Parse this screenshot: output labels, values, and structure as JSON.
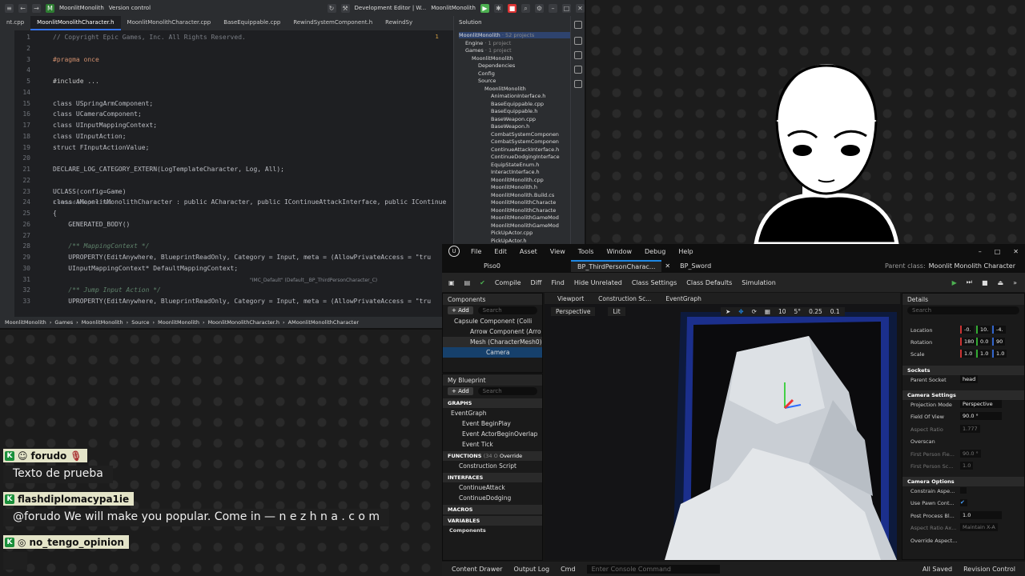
{
  "ide": {
    "title_items": [
      "MoonlitMonolith",
      "Version control",
      "Development Editor | W...",
      "MoonlitMonolith"
    ],
    "tabs": [
      "nt.cpp",
      "MoonlitMonolithCharacter.h",
      "MoonlitMonolithCharacter.cpp",
      "BaseEquippable.cpp",
      "RewindSystemComponent.h",
      "RewindSy"
    ],
    "inspection": "1",
    "lines": [
      {
        "n": "1",
        "t": "// Copyright Epic Games, Inc. All Rights Reserved.",
        "c": "cm"
      },
      {
        "n": "2",
        "t": ""
      },
      {
        "n": "3",
        "t": "#pragma once",
        "c": "kw"
      },
      {
        "n": "4",
        "t": ""
      },
      {
        "n": "5",
        "t": "#include ...",
        "c": "cls"
      },
      {
        "n": "14",
        "t": ""
      },
      {
        "n": "15",
        "t": "class USpringArmComponent;"
      },
      {
        "n": "16",
        "t": "class UCameraComponent;"
      },
      {
        "n": "17",
        "t": "class UInputMappingContext;"
      },
      {
        "n": "18",
        "t": "class UInputAction;"
      },
      {
        "n": "19",
        "t": "struct FInputActionValue;"
      },
      {
        "n": "20",
        "t": ""
      },
      {
        "n": "21",
        "t": "DECLARE_LOG_CATEGORY_EXTERN(LogTemplateCharacter, Log, All);"
      },
      {
        "n": "22",
        "t": ""
      },
      {
        "n": "23",
        "t": "UCLASS(config=Game)"
      },
      {
        "n": "24",
        "t": "class AMoonlitMonolithCharacter : public ACharacter, public IContinueAttackInterface, public IContinue"
      },
      {
        "n": "25",
        "t": "{"
      },
      {
        "n": "26",
        "t": "    GENERATED_BODY()"
      },
      {
        "n": "27",
        "t": ""
      },
      {
        "n": "28",
        "t": "    /** MappingContext */",
        "c": "cmg"
      },
      {
        "n": "29",
        "t": "    UPROPERTY(EditAnywhere, BlueprintReadOnly, Category = Input, meta = (AllowPrivateAccess = \"tru"
      },
      {
        "n": "30",
        "t": "    UInputMappingContext* DefaultMappingContext;"
      },
      {
        "n": "31",
        "t": ""
      },
      {
        "n": "32",
        "t": "    /** Jump Input Action */",
        "c": "cmg"
      },
      {
        "n": "33",
        "t": "    UPROPERTY(EditAnywhere, BlueprintReadOnly, Category = Input, meta = (AllowPrivateAccess = \"tru"
      }
    ],
    "hint_derived": "1 derived blueprint class",
    "hint_imc": "\"IMC_Default\" (Default__BP_ThirdPersonCharacter_C)",
    "breadcrumb": [
      "MoonlitMonolith",
      "Games",
      "MoonlitMonolith",
      "Source",
      "MoonlitMonolith",
      "MoonlitMonolithCharacter.h",
      "AMoonlitMonolithCharacter"
    ],
    "solution": {
      "header": "Solution",
      "nodes": [
        {
          "label": "MoonlitMonolith",
          "dim": " · 52 projects",
          "lvl": 0
        },
        {
          "label": "Engine",
          "dim": " · 1 project",
          "lvl": 1
        },
        {
          "label": "Games",
          "dim": " · 1 project",
          "lvl": 1
        },
        {
          "label": "MoonlitMonolith",
          "dim": "",
          "lvl": 2
        },
        {
          "label": "Dependencies",
          "dim": "",
          "lvl": 3
        },
        {
          "label": "Config",
          "dim": "",
          "lvl": 3
        },
        {
          "label": "Source",
          "dim": "",
          "lvl": 3
        },
        {
          "label": "MoonlitMonolith",
          "dim": "",
          "lvl": 4
        },
        {
          "label": "AnimationInterface.h",
          "dim": "",
          "lvl": 5
        },
        {
          "label": "BaseEquippable.cpp",
          "dim": "",
          "lvl": 5
        },
        {
          "label": "BaseEquippable.h",
          "dim": "",
          "lvl": 5
        },
        {
          "label": "BaseWeapon.cpp",
          "dim": "",
          "lvl": 5
        },
        {
          "label": "BaseWeapon.h",
          "dim": "",
          "lvl": 5
        },
        {
          "label": "CombatSystemComponen",
          "dim": "",
          "lvl": 5
        },
        {
          "label": "CombatSystemComponen",
          "dim": "",
          "lvl": 5
        },
        {
          "label": "ContinueAttackInterface.h",
          "dim": "",
          "lvl": 5
        },
        {
          "label": "ContinueDodgingInterface",
          "dim": "",
          "lvl": 5
        },
        {
          "label": "EquipStateEnum.h",
          "dim": "",
          "lvl": 5
        },
        {
          "label": "InteractInterface.h",
          "dim": "",
          "lvl": 5
        },
        {
          "label": "MoonlitMonolith.cpp",
          "dim": "",
          "lvl": 5
        },
        {
          "label": "MoonlitMonolith.h",
          "dim": "",
          "lvl": 5
        },
        {
          "label": "MoonlitMonolith.Build.cs",
          "dim": "",
          "lvl": 5
        },
        {
          "label": "MoonlitMonolithCharacte",
          "dim": "",
          "lvl": 5
        },
        {
          "label": "MoonlitMonolithCharacte",
          "dim": "",
          "lvl": 5
        },
        {
          "label": "MoonlitMonolithGameMod",
          "dim": "",
          "lvl": 5
        },
        {
          "label": "MoonlitMonolithGameMod",
          "dim": "",
          "lvl": 5
        },
        {
          "label": "PickUpActor.cpp",
          "dim": "",
          "lvl": 5
        },
        {
          "label": "PickUpActor.h",
          "dim": "",
          "lvl": 5
        }
      ]
    }
  },
  "chat": [
    {
      "user": "forudo",
      "msg": "Texto de prueba"
    },
    {
      "user": "flashdiplomacypa1ie",
      "msg": "@forudo We will make you popular. Come in — n e z h n a . c o m"
    },
    {
      "user": "no_tengo_opinion",
      "msg": ""
    }
  ],
  "chat_badge": "K",
  "ue": {
    "menu": [
      "File",
      "Edit",
      "Asset",
      "View",
      "Tools",
      "Window",
      "Debug",
      "Help"
    ],
    "project_tab": "Piso0",
    "tabs": [
      "BP_ThirdPersonCharac...",
      "BP_Sword"
    ],
    "parent_class_label": "Parent class:",
    "parent_class": "Moonlit Monolith Character",
    "toolbar": [
      "Compile",
      "Diff",
      "Find",
      "Hide Unrelated",
      "Class Settings",
      "Class Defaults",
      "Simulation"
    ],
    "components": {
      "header": "Components",
      "add": "+ Add",
      "search": "Search",
      "items": [
        "Capsule Component (Colli",
        "Arrow Component (Arro",
        "Mesh (CharacterMesh0)",
        "Camera"
      ]
    },
    "myblueprint": {
      "header": "My Blueprint",
      "add": "+ Add",
      "search": "Search",
      "graphs_label": "GRAPHS",
      "graphs": [
        "EventGraph",
        "Event BeginPlay",
        "Event ActorBeginOverlap",
        "Event Tick"
      ],
      "functions_label": "FUNCTIONS",
      "functions_count": "(34 O",
      "override": "Override",
      "functions": [
        "Construction Script"
      ],
      "interfaces_label": "INTERFACES",
      "interfaces": [
        "ContinueAttack",
        "ContinueDodging"
      ],
      "macros_label": "MACROS",
      "variables_label": "VARIABLES",
      "components_label": "Components"
    },
    "viewport_tabs": [
      "Viewport",
      "Construction Sc...",
      "EventGraph"
    ],
    "viewport_buttons": [
      "Perspective",
      "Lit"
    ],
    "viewport_readouts": [
      "10",
      "5°",
      "0.25",
      "0.1"
    ],
    "details": {
      "header": "Details",
      "search": "Search",
      "transform": [
        {
          "label": "Location",
          "vals": [
            "-0.",
            "10.",
            "-4."
          ]
        },
        {
          "label": "Rotation",
          "vals": [
            "180",
            "0.0",
            "90"
          ]
        },
        {
          "label": "Scale",
          "vals": [
            "1.0",
            "1.0",
            "1.0"
          ]
        }
      ],
      "sockets_label": "Sockets",
      "parent_socket_label": "Parent Socket",
      "parent_socket": "head",
      "camera_settings_label": "Camera Settings",
      "projection_mode_label": "Projection Mode",
      "projection_mode": "Perspective",
      "fov_label": "Field Of View",
      "fov": "90.0 °",
      "aspect_label": "Aspect Ratio",
      "aspect": "1.777",
      "overscan_label": "Overscan",
      "first_fov_label": "First Person Fie...",
      "first_fov": "90.0 °",
      "first_scale_label": "First Person Sc...",
      "first_scale": "1.0",
      "camera_options_label": "Camera Options",
      "constrain_label": "Constrain Aspe...",
      "pawn_label": "Use Pawn Cont...",
      "post_blend_label": "Post Process Bl...",
      "post_blend": "1.0",
      "axis_label": "Aspect Ratio Ax...",
      "axis_value": "Maintain X-A",
      "override_label": "Override Aspect..."
    },
    "status": [
      "Content Drawer",
      "Output Log",
      "Cmd",
      "Enter Console Command",
      "All Saved",
      "Revision Control"
    ]
  }
}
